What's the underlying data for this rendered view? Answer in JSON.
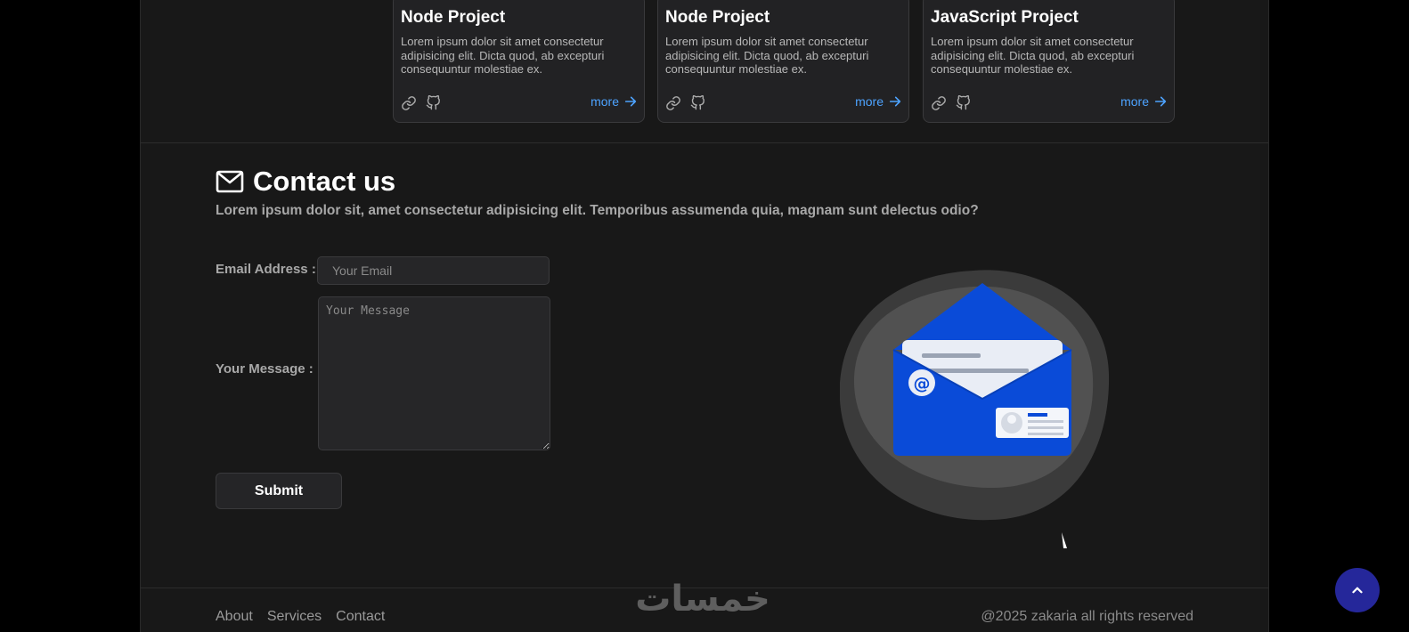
{
  "projects": [
    {
      "title": "Node Project",
      "desc": "Lorem ipsum dolor sit amet consectetur adipisicing elit. Dicta quod, ab excepturi consequuntur molestiae ex.",
      "more": "more"
    },
    {
      "title": "Node Project",
      "desc": "Lorem ipsum dolor sit amet consectetur adipisicing elit. Dicta quod, ab excepturi consequuntur molestiae ex.",
      "more": "more"
    },
    {
      "title": "JavaScript Project",
      "desc": "Lorem ipsum dolor sit amet consectetur adipisicing elit. Dicta quod, ab excepturi consequuntur molestiae ex.",
      "more": "more"
    }
  ],
  "contact": {
    "title": "Contact us",
    "intro": "Lorem ipsum dolor sit, amet consectetur adipisicing elit. Temporibus assumenda quia, magnam sunt delectus odio?",
    "email_label": "Email Address :",
    "email_placeholder": "Your Email",
    "message_label": "Your Message :",
    "message_placeholder": "Your Message",
    "submit_label": "Submit"
  },
  "footer": {
    "nav": [
      "About",
      "Services",
      "Contact"
    ],
    "copyright": "@2025 zakaria all rights reserved",
    "watermark": "خمسات"
  },
  "colors": {
    "accent_link": "#4da3ff",
    "envelope_blue": "#0a4bd8",
    "scroll_top_bg": "#25279a"
  }
}
